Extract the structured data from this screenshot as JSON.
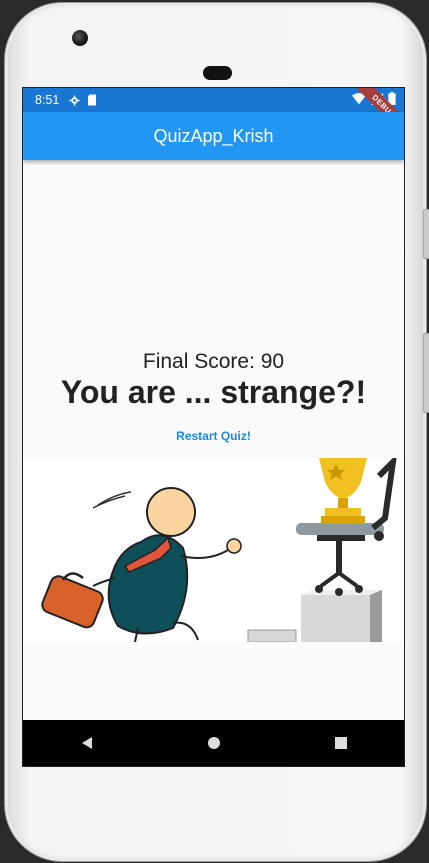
{
  "status_bar": {
    "time": "8:51",
    "icons": [
      "settings-icon",
      "sd-card-icon",
      "wifi-icon",
      "signal-icon",
      "battery-icon"
    ]
  },
  "debug_banner": "DEBUG",
  "app_bar": {
    "title": "QuizApp_Krish"
  },
  "result": {
    "final_score": "Final Score: 90",
    "phrase": "You are ... strange?!",
    "restart_label": "Restart Quiz!"
  },
  "illustration": {
    "subject": "man-running-to-trophy"
  },
  "nav_bar": {
    "buttons": [
      "back-icon",
      "home-icon",
      "recents-icon"
    ]
  },
  "colors": {
    "status_bar": "#1976d2",
    "app_bar": "#2196f3",
    "accent": "#1e88e5",
    "debug_banner": "#a33e3e"
  }
}
